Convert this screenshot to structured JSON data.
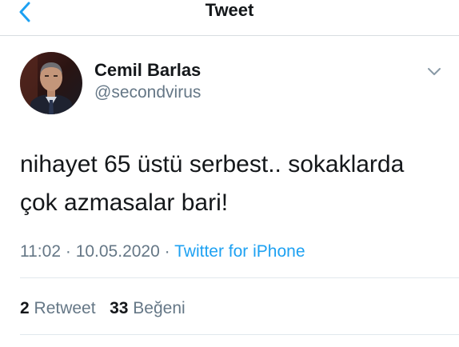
{
  "nav": {
    "title": "Tweet",
    "back_icon": "chevron-left-icon",
    "accent_color": "#1da1f2"
  },
  "tweet": {
    "author": {
      "display_name": "Cemil Barlas",
      "handle": "@secondvirus"
    },
    "text_lines": [
      "nihayet 65 üstü serbest.. sokaklarda",
      "çok azmasalar bari!"
    ],
    "time": "11:02",
    "date": "10.05.2020",
    "separator": "·",
    "source": "Twitter for iPhone",
    "more_icon": "chevron-down-icon"
  },
  "stats": {
    "retweets_count": "2",
    "retweets_label": "Retweet",
    "likes_count": "33",
    "likes_label": "Beğeni"
  }
}
